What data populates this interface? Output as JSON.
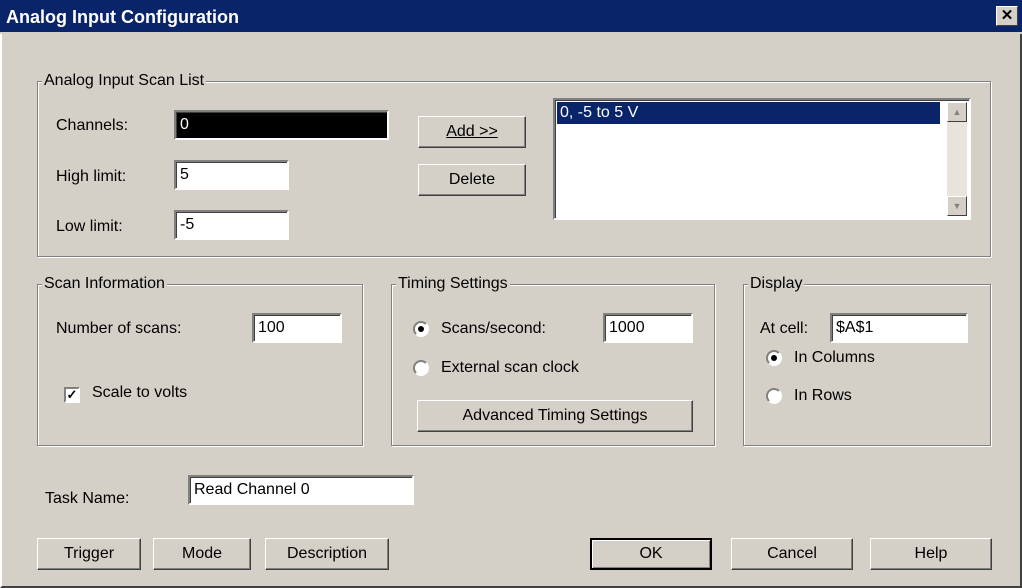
{
  "window": {
    "title": "Analog Input Configuration",
    "close_glyph": "✕"
  },
  "scan_list": {
    "legend": "Analog Input Scan List",
    "channels_label": "Channels:",
    "channels_value": "0",
    "high_limit_label": "High limit:",
    "high_limit_value": "5",
    "low_limit_label": "Low limit:",
    "low_limit_value": "-5",
    "add_button": "Add >>",
    "delete_button": "Delete",
    "list_items": [
      "0, -5 to 5 V"
    ]
  },
  "scan_info": {
    "legend": "Scan Information",
    "num_scans_label": "Number of scans:",
    "num_scans_value": "100",
    "scale_to_volts_label": "Scale to volts",
    "scale_to_volts_checked": true
  },
  "timing": {
    "legend": "Timing Settings",
    "scans_per_second_label": "Scans/second:",
    "scans_per_second_value": "1000",
    "external_clock_label": "External scan clock",
    "selected": "scans_per_second",
    "advanced_button": "Advanced Timing Settings"
  },
  "display": {
    "legend": "Display",
    "at_cell_label": "At cell:",
    "at_cell_value": "$A$1",
    "in_columns_label": "In Columns",
    "in_rows_label": "In Rows",
    "selected": "columns"
  },
  "task": {
    "label": "Task Name:",
    "value": "Read Channel 0"
  },
  "buttons": {
    "trigger": "Trigger",
    "mode": "Mode",
    "description": "Description",
    "ok": "OK",
    "cancel": "Cancel",
    "help": "Help"
  }
}
